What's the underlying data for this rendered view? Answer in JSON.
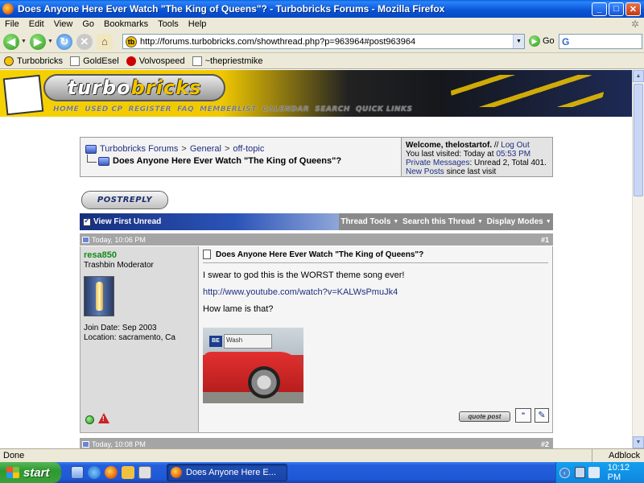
{
  "window": {
    "title": "Does Anyone Here Ever Watch \"The King of Queens\"? - Turbobricks Forums - Mozilla Firefox",
    "minimize_glyph": "_",
    "maximize_glyph": "□",
    "close_glyph": "✕"
  },
  "menu": [
    "File",
    "Edit",
    "View",
    "Go",
    "Bookmarks",
    "Tools",
    "Help"
  ],
  "nav": {
    "url": "http://forums.turbobricks.com/showthread.php?p=963964#post963964",
    "go_label": "Go",
    "search_value": ""
  },
  "bookmarks": [
    "Turbobricks",
    "GoldEsel",
    "Volvospeed",
    "~thepriestmike"
  ],
  "site": {
    "logo_part1": "turbo",
    "logo_part2": "bricks",
    "nav_links": [
      "HOME",
      "USED CP",
      "REGISTER",
      "FAQ",
      "MEMBERLIST",
      "CALENDAR",
      "SEARCH",
      "QUICK LINKS"
    ]
  },
  "breadcrumb": {
    "items": [
      "Turbobricks Forums",
      "General",
      "off-topic"
    ],
    "separator": ">",
    "thread_title": "Does Anyone Here Ever Watch \"The King of Queens\"?"
  },
  "welcome": {
    "greeting": "Welcome, thelostartof.",
    "sep": "//",
    "logout": "Log Out",
    "last_visit_prefix": "You last visited: Today at",
    "last_visit_time": "05:53 PM",
    "pm_label": "Private Messages",
    "pm_counts": ": Unread 2, Total 401.",
    "new_posts": "New Posts",
    "new_posts_suffix": "since last visit"
  },
  "buttons": {
    "post_reply": "POSTREPLY",
    "quote_post": "quote post"
  },
  "toolbar": {
    "view_first_unread": "View First Unread",
    "items": [
      "Thread Tools",
      "Search this Thread",
      "Display Modes"
    ]
  },
  "post1": {
    "date": "Today, 10:06 PM",
    "number": "#1",
    "username": "resa850",
    "user_title": "Trashbin Moderator",
    "join_date": "Join Date: Sep 2003",
    "location": "Location: sacramento, Ca",
    "title": "Does Anyone Here Ever Watch \"The King of Queens\"?",
    "line1": "I swear to god this is the WORST theme song ever!",
    "link": "http://www.youtube.com/watch?v=KALWsPmuJk4",
    "line2": "How lame is that?",
    "photo_sign_text": "Wash",
    "photo_sign2_text": "BE"
  },
  "post2": {
    "date": "Today, 10:08 PM",
    "number": "#2"
  },
  "status": {
    "text": "Done",
    "adblock": "Adblock"
  },
  "taskbar": {
    "start": "start",
    "task_title": "Does Anyone Here E...",
    "clock": "10:12 PM"
  }
}
